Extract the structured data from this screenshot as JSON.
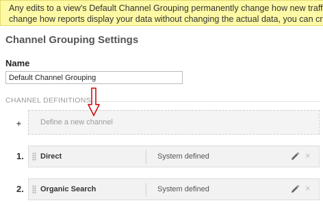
{
  "notice": {
    "line1": "Any edits to a view's Default Channel Grouping permanently change how new traffic is classified",
    "line2": "change how reports display your data without changing the actual data, you can create a new Channel Grouping"
  },
  "page_title": "Channel Grouping Settings",
  "name_field": {
    "label": "Name",
    "value": "Default Channel Grouping"
  },
  "channel_definitions": {
    "section_label": "CHANNEL DEFINITIONS",
    "add_symbol": "+",
    "define_new_label": "Define a new channel",
    "arrow_color": "#cc0000",
    "rows": [
      {
        "index": "1.",
        "name": "Direct",
        "type": "System defined",
        "edit_icon": "pencil-icon",
        "remove_icon": "close-icon",
        "remove_glyph": "×"
      },
      {
        "index": "2.",
        "name": "Organic Search",
        "type": "System defined",
        "edit_icon": "pencil-icon",
        "remove_icon": "close-icon",
        "remove_glyph": "×"
      }
    ]
  }
}
